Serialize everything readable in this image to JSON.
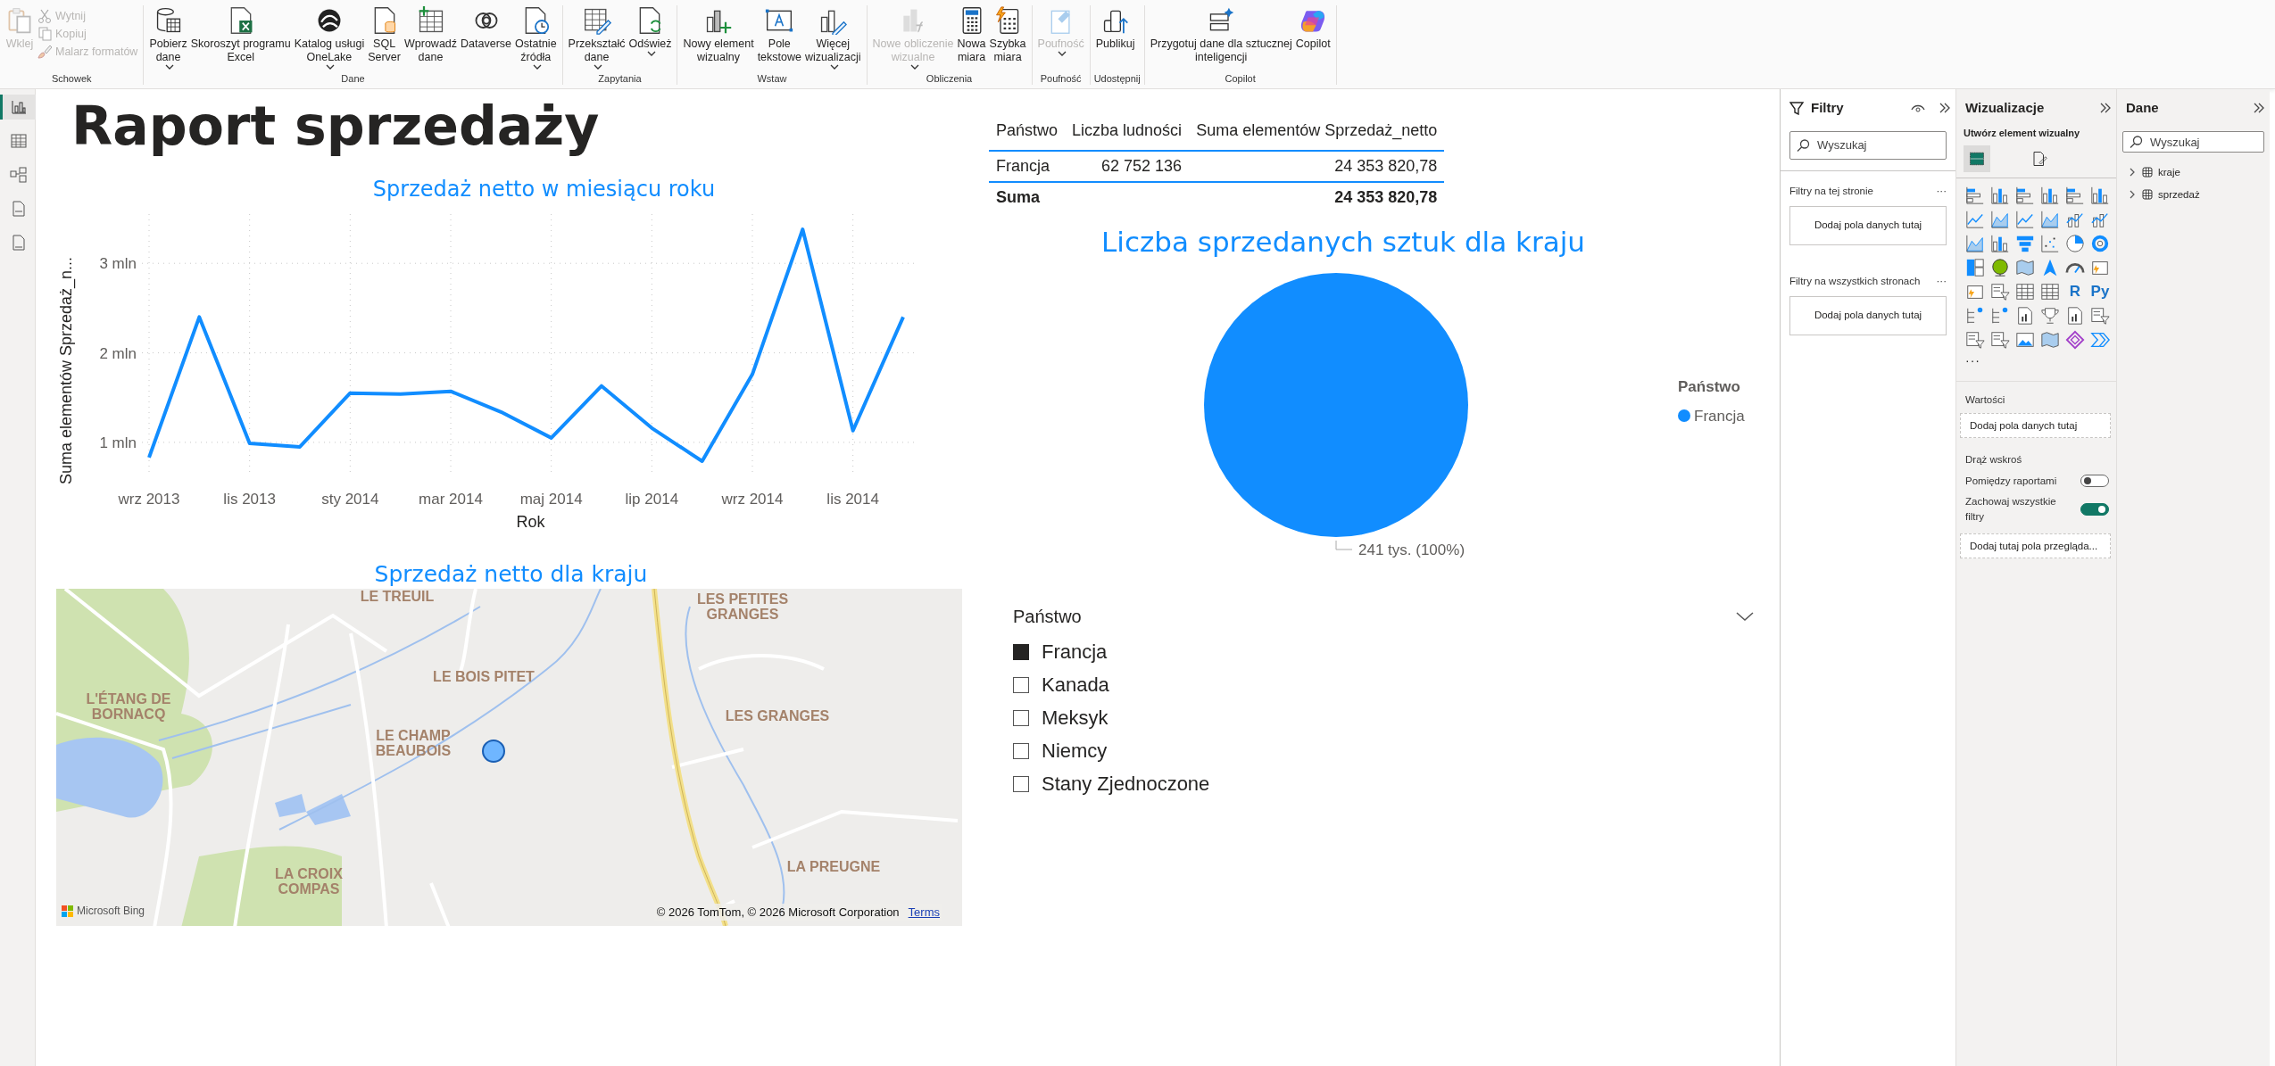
{
  "ribbon": {
    "groups": [
      {
        "label": "Schowek",
        "buttons": [
          {
            "kind": "large",
            "lines": [
              "Wklej"
            ],
            "dropdown": false,
            "disabled": true
          },
          {
            "kind": "small",
            "lines": [
              "Wytnij"
            ],
            "disabled": true
          },
          {
            "kind": "small",
            "lines": [
              "Kopiuj"
            ],
            "disabled": true
          },
          {
            "kind": "small",
            "lines": [
              "Malarz formatów"
            ],
            "disabled": true
          }
        ]
      },
      {
        "label": "Dane",
        "buttons": [
          {
            "kind": "large",
            "lines": [
              "Pobierz",
              "dane"
            ],
            "dropdown": true,
            "disabled": false
          },
          {
            "kind": "large",
            "lines": [
              "Skoroszyt programu",
              "Excel"
            ],
            "dropdown": false,
            "disabled": false
          },
          {
            "kind": "large",
            "lines": [
              "Katalog usługi",
              "OneLake"
            ],
            "dropdown": true,
            "disabled": false
          },
          {
            "kind": "large",
            "lines": [
              "SQL",
              "Server"
            ],
            "dropdown": false,
            "disabled": false
          },
          {
            "kind": "large",
            "lines": [
              "Wprowadź",
              "dane"
            ],
            "dropdown": false,
            "disabled": false
          },
          {
            "kind": "large",
            "lines": [
              "Dataverse"
            ],
            "dropdown": false,
            "disabled": false
          },
          {
            "kind": "large",
            "lines": [
              "Ostatnie",
              "źródła"
            ],
            "dropdown": true,
            "disabled": false
          }
        ]
      },
      {
        "label": "Zapytania",
        "buttons": [
          {
            "kind": "large",
            "lines": [
              "Przekształć",
              "dane"
            ],
            "dropdown": true,
            "disabled": false
          },
          {
            "kind": "large",
            "lines": [
              "Odśwież"
            ],
            "dropdown": true,
            "disabled": false
          }
        ]
      },
      {
        "label": "Wstaw",
        "buttons": [
          {
            "kind": "large",
            "lines": [
              "Nowy element",
              "wizualny"
            ],
            "dropdown": false,
            "disabled": false
          },
          {
            "kind": "large",
            "lines": [
              "Pole",
              "tekstowe"
            ],
            "dropdown": false,
            "disabled": false
          },
          {
            "kind": "large",
            "lines": [
              "Więcej",
              "wizualizacji"
            ],
            "dropdown": true,
            "disabled": false
          }
        ]
      },
      {
        "label": "Obliczenia",
        "buttons": [
          {
            "kind": "large",
            "lines": [
              "Nowe obliczenie",
              "wizualne"
            ],
            "dropdown": true,
            "disabled": true
          },
          {
            "kind": "large",
            "lines": [
              "Nowa",
              "miara"
            ],
            "dropdown": false,
            "disabled": false
          },
          {
            "kind": "large",
            "lines": [
              "Szybka",
              "miara"
            ],
            "dropdown": false,
            "disabled": false
          }
        ]
      },
      {
        "label": "Poufność",
        "buttons": [
          {
            "kind": "large",
            "lines": [
              "Poufność"
            ],
            "dropdown": true,
            "disabled": true
          }
        ]
      },
      {
        "label": "Udostępnij",
        "buttons": [
          {
            "kind": "large",
            "lines": [
              "Publikuj"
            ],
            "dropdown": false,
            "disabled": false
          }
        ]
      },
      {
        "label": "Copilot",
        "buttons": [
          {
            "kind": "large",
            "lines": [
              "Przygotuj dane dla sztucznej",
              "inteligencji"
            ],
            "dropdown": false,
            "disabled": false
          },
          {
            "kind": "large",
            "lines": [
              "Copilot"
            ],
            "dropdown": false,
            "disabled": false
          }
        ]
      }
    ]
  },
  "nav": [
    {
      "selected": true
    },
    {
      "selected": false
    },
    {
      "selected": false
    },
    {
      "selected": false
    },
    {
      "selected": false
    }
  ],
  "report": {
    "title": "Raport sprzedaży",
    "line_chart": {
      "chart_data": {
        "type": "line",
        "title": "Sprzedaż netto w miesiącu roku",
        "xlabel": "Rok",
        "ylabel": "Suma elementów Sprzedaż_n...",
        "categories": [
          "wrz 2013",
          null,
          "lis 2013",
          null,
          "sty 2014",
          null,
          "mar 2014",
          null,
          "maj 2014",
          null,
          "lip 2014",
          null,
          "wrz 2014",
          null,
          "lis 2014",
          null
        ],
        "values": [
          0.83,
          2.4,
          0.99,
          0.95,
          1.55,
          1.54,
          1.57,
          1.34,
          1.05,
          1.63,
          1.16,
          0.79,
          1.76,
          3.38,
          1.13,
          2.4
        ],
        "ylim": [
          0.65,
          3.55
        ],
        "grid": true,
        "yticks": [
          {
            "value": 1,
            "label": "1 mln"
          },
          {
            "value": 2,
            "label": "2 mln"
          },
          {
            "value": 3,
            "label": "3 mln"
          }
        ]
      }
    },
    "map": {
      "title": "Sprzedaż netto dla kraju",
      "places": [
        "LE TREUIL",
        "LES PETITES GRANGES",
        "LE BOIS PITET",
        "L'ÉTANG DE BORNACQ",
        "LE CHAMP BEAUBOIS",
        "LES GRANGES",
        "LA CROIX COMPAS",
        "LA PREUGNE"
      ],
      "brand": "Microsoft Bing",
      "attribution": "© 2026 TomTom, © 2026 Microsoft Corporation",
      "terms": "Terms"
    },
    "table": {
      "columns": [
        "Państwo",
        "Liczba ludności",
        "Suma elementów Sprzedaż_netto"
      ],
      "rows": [
        [
          "Francja",
          "62 752 136",
          "24 353 820,78"
        ]
      ],
      "total": {
        "label": "Suma",
        "value": "24 353 820,78"
      }
    },
    "pie": {
      "chart_data": {
        "type": "pie",
        "title": "Liczba sprzedanych sztuk dla kraju",
        "categories": [
          "Francja"
        ],
        "values": [
          100
        ],
        "value_labels": [
          "241 tys. (100%)"
        ]
      },
      "legend": {
        "title": "Państwo",
        "items": [
          {
            "color": "#118dff"
          }
        ]
      }
    },
    "slicer": {
      "title": "Państwo",
      "items": [
        {
          "label": "Francja",
          "checked": true
        },
        {
          "label": "Kanada",
          "checked": false
        },
        {
          "label": "Meksyk",
          "checked": false
        },
        {
          "label": "Niemcy",
          "checked": false
        },
        {
          "label": "Stany Zjednoczone",
          "checked": false
        }
      ]
    }
  },
  "filters_pane": {
    "title": "Filtry",
    "search": {
      "placeholder": "Wyszukaj"
    },
    "sections": [
      {
        "heading": "Filtry na tej stronie",
        "more": "···",
        "drop": "Dodaj pola danych tutaj"
      },
      {
        "heading": "Filtry na wszystkich stronach",
        "more": "···",
        "drop": "Dodaj pola danych tutaj"
      }
    ]
  },
  "visualizations_pane": {
    "title": "Wizualizacje",
    "subtitle": "Utwórz element wizualny",
    "tabs": [
      {
        "selected": true
      },
      {
        "selected": false
      }
    ],
    "visual_types": [
      {
        "kind": "bar"
      },
      {
        "kind": "column"
      },
      {
        "kind": "bar"
      },
      {
        "kind": "column"
      },
      {
        "kind": "bar"
      },
      {
        "kind": "column"
      },
      {
        "kind": "line"
      },
      {
        "kind": "area"
      },
      {
        "kind": "line"
      },
      {
        "kind": "area"
      },
      {
        "kind": "combo"
      },
      {
        "kind": "combo"
      },
      {
        "kind": "area"
      },
      {
        "kind": "column"
      },
      {
        "kind": "funnel"
      },
      {
        "kind": "scatter"
      },
      {
        "kind": "pie"
      },
      {
        "kind": "donut"
      },
      {
        "kind": "treemap"
      },
      {
        "kind": "globe"
      },
      {
        "kind": "map"
      },
      {
        "kind": "arrow"
      },
      {
        "kind": "gauge"
      },
      {
        "kind": "card"
      },
      {
        "kind": "card"
      },
      {
        "kind": "slicer"
      },
      {
        "kind": "table"
      },
      {
        "kind": "table"
      },
      {
        "kind": "letter",
        "label": "R"
      },
      {
        "kind": "letter",
        "label": "Py"
      },
      {
        "kind": "tree"
      },
      {
        "kind": "tree"
      },
      {
        "kind": "doc"
      },
      {
        "kind": "trophy"
      },
      {
        "kind": "doc"
      },
      {
        "kind": "slicer"
      },
      {
        "kind": "slicer"
      },
      {
        "kind": "slicer"
      },
      {
        "kind": "image"
      },
      {
        "kind": "map"
      },
      {
        "kind": "shape"
      },
      {
        "kind": "chevrons"
      }
    ],
    "more": "···",
    "wells": [
      {
        "label": "Wartości",
        "drop": "Dodaj pola danych tutaj"
      }
    ],
    "drillthrough": {
      "heading": "Drąż wskroś",
      "toggles": [
        {
          "label": "Pomiędzy raportami",
          "on": false
        },
        {
          "label": "Zachowaj wszystkie filtry",
          "on": true
        }
      ],
      "drop": "Dodaj tutaj pola przegląda..."
    }
  },
  "data_pane": {
    "title": "Dane",
    "search": {
      "placeholder": "Wyszukaj"
    },
    "tables": [
      {
        "name": "kraje",
        "expanded": false
      },
      {
        "name": "sprzedaż",
        "expanded": false
      }
    ]
  }
}
